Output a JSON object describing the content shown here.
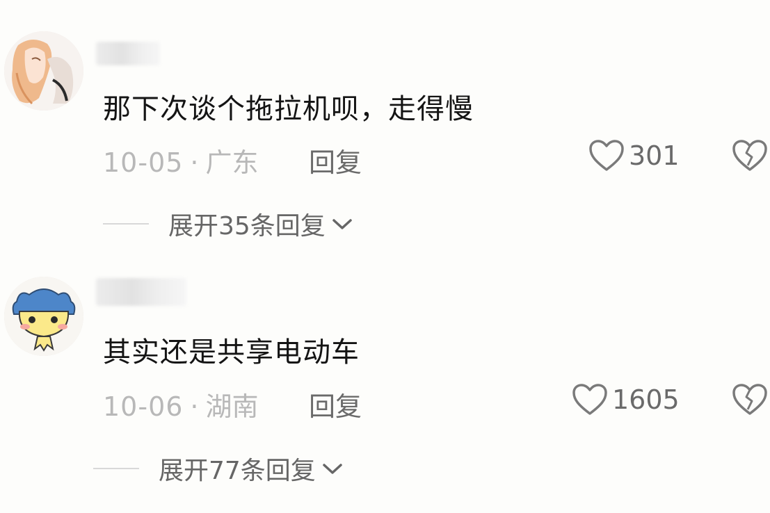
{
  "comments": [
    {
      "text": "那下次谈个拖拉机呗，走得慢",
      "date": "10-05",
      "separator": "·",
      "location": "广东",
      "reply_label": "回复",
      "likes": "301",
      "expand_label": "展开35条回复"
    },
    {
      "text": "其实还是共享电动车",
      "date": "10-06",
      "separator": "·",
      "location": "湖南",
      "reply_label": "回复",
      "likes": "1605",
      "expand_label": "展开77条回复"
    }
  ],
  "icons": {
    "like": "heart-outline-icon",
    "dislike": "broken-heart-icon",
    "expand": "chevron-down-icon"
  },
  "colors": {
    "text": "#141414",
    "meta": "#b8b8b8",
    "action": "#6a6a6a"
  }
}
